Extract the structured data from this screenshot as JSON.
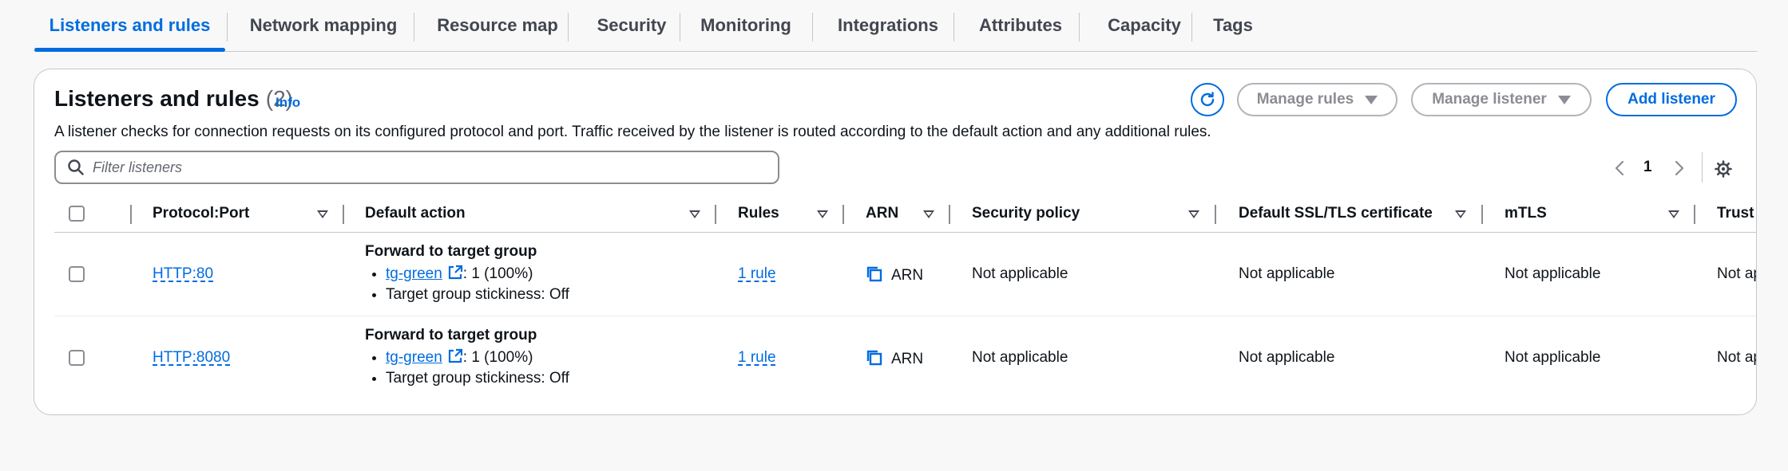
{
  "tabs": [
    {
      "label": "Listeners and rules",
      "active": true
    },
    {
      "label": "Network mapping"
    },
    {
      "label": "Resource map"
    },
    {
      "label": "Security"
    },
    {
      "label": "Monitoring"
    },
    {
      "label": "Integrations"
    },
    {
      "label": "Attributes"
    },
    {
      "label": "Capacity"
    },
    {
      "label": "Tags"
    }
  ],
  "panel": {
    "title": "Listeners and rules",
    "count": "(2)",
    "info": "Info",
    "description": "A listener checks for connection requests on its configured protocol and port. Traffic received by the listener is routed according to the default action and any additional rules.",
    "buttons": {
      "refresh_icon": "refresh-icon",
      "manage_rules": "Manage rules",
      "manage_listener": "Manage listener",
      "add_listener": "Add listener"
    },
    "filter": {
      "placeholder": "Filter listeners",
      "value": ""
    },
    "pagination": {
      "page": "1"
    }
  },
  "table": {
    "columns": [
      "Protocol:Port",
      "Default action",
      "Rules",
      "ARN",
      "Security policy",
      "Default SSL/TLS certificate",
      "mTLS",
      "Trust store"
    ],
    "rows": [
      {
        "protocol_port": "HTTP:80",
        "action_title": "Forward to target group",
        "target_group": "tg-green",
        "target_weight": ": 1 (100%)",
        "stickiness": "Target group stickiness: Off",
        "rules": "1 rule",
        "arn": "ARN",
        "security_policy": "Not applicable",
        "ssl_cert": "Not applicable",
        "mtls": "Not applicable",
        "trust_store": "Not applicable"
      },
      {
        "protocol_port": "HTTP:8080",
        "action_title": "Forward to target group",
        "target_group": "tg-green",
        "target_weight": ": 1 (100%)",
        "stickiness": "Target group stickiness: Off",
        "rules": "1 rule",
        "arn": "ARN",
        "security_policy": "Not applicable",
        "ssl_cert": "Not applicable",
        "mtls": "Not applicable",
        "trust_store": "Not applicable"
      }
    ]
  },
  "colors": {
    "accent": "#006ce0",
    "text": "#0f141a",
    "border": "#c6c6cd"
  }
}
